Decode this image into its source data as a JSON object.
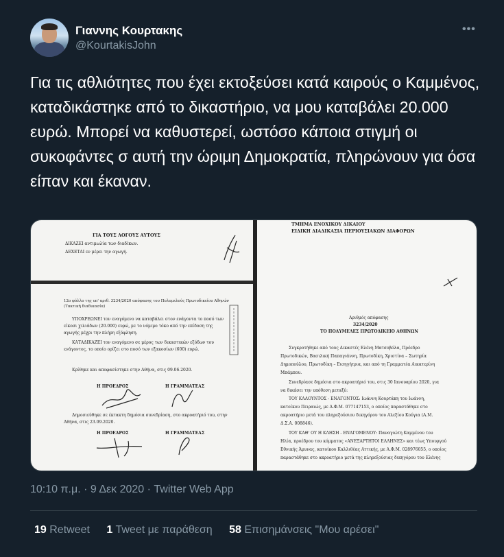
{
  "user": {
    "name": "Γιαννης Κουρτακης",
    "handle": "@KourtakisJohn"
  },
  "tweet": {
    "text": "Για τις αθλιότητες που έχει εκτοξεύσει κατά καιρούς ο Καμμένος, καταδικάστηκε από το δικαστήριο, να μου καταβάλει 20.000 ευρώ. Μπορεί να καθυστερεί, ωστόσο κάποια στιγμή οι συκοφάντες σ αυτή την ώριμη Δημοκρατία, πληρώνουν για όσα είπαν και έκαναν."
  },
  "more_label": "•••",
  "document_left": {
    "heading": "ΓΙΑ ΤΟΥΣ ΛΟΓΟΥΣ ΑΥΤΟΥΣ",
    "line1": "ΔΙΚΑΖΕΙ αντιμωλία των διαδίκων.",
    "line2": "ΔΕΧΕΤΑΙ εν μέρει την αγωγή.",
    "page_ref": "12ο φύλλο της υπ' αριθ. 3234/2020 απόφασης του Πολυμελούς Πρωτοδικείου Αθηνών",
    "page_ref2": "(Τακτική διαδικασία)",
    "p1": "ΥΠΟΧΡΕΩΝΕΙ τον εναγόμενο να καταβάλει στον ενάγοντα το ποσό των",
    "p1b": "είκοσι χιλιάδων (20.000) ευρώ, με το νόμιμο τόκο από την επίδοση της",
    "p1c": "αγωγής μέχρι την πλήρη εξόφληση.",
    "p2": "ΚΑΤΑΔΙΚΑΖΕΙ τον εναγόμενο σε μέρος των δικαστικών εξόδων του",
    "p2b": "ενάγοντος, το οποίο ορίζει στο ποσό των εξακοσίων (600) ευρώ.",
    "decided": "Κρίθηκε και αποφασίστηκε στην Αθήνα, στις 09.06.2020.",
    "president": "Η ΠΡΟΕΔΡΟΣ",
    "secretary": "Η ΓΡΑΜΜΑΤΕΑΣ",
    "published": "Δημοσιεύθηκε σε έκτακτη δημόσια συνεδρίαση, στο ακροατήριό του, στην",
    "published2": "Αθήνα, στις 23.09.2020.",
    "president2": "Η ΠΡΟΕΔΡΟΣ",
    "secretary2": "Η ΓΡΑΜΜΑΤΕΑΣ"
  },
  "document_right": {
    "h1": "ΤΜΗΜΑ ΕΝΟΧΙΚΟΥ ΔΙΚΑΙΟΥ",
    "h2": "ΕΙΔΙΚΗ ΔΙΑΔΙΚΑΣΙΑ ΠΕΡΙΟΥΣΙΑΚΩΝ ΔΙΑΦΟΡΩΝ",
    "num_label": "Αριθμός απόφασης",
    "num": "3234/2020",
    "court": "ΤΟ ΠΟΛΥΜΕΛΕΣ ΠΡΩΤΟΔΙΚΕΙΟ ΑΘΗΝΩΝ",
    "r1": "Συγκροτήθηκε από τους Δικαστές Ελένη Ματσοβόλα, Πρόεδρο",
    "r2": "Πρωτοδικών, Βασιλική Παπαγιάννη, Πρωτοδίκη, Χριστίνα – Σωτηρία",
    "r3": "Δημοπούλου, Πρωτοδίκη – Εισηγήτρια, και από τη Γραμματέα Αικατερίνη",
    "r4": "Μπάμπου.",
    "r5": "Συνεδρίασε δημόσια στο ακροατήριό του, στις 30 Ιανουαρίου 2020, για",
    "r6": "να δικάσει την υπόθεση μεταξύ:",
    "r7": "ΤΟΥ ΚΑΛΟΥΝΤΟΣ - ΕΝΑΓΟΝΤΟΣ: Ιωάννη Κουρτάκη του Ιωάννη,",
    "r8": "κατοίκου Πειραιώς, με Α.Φ.Μ. 077147153, ο οποίος παραστάθηκε στο",
    "r9": "ακροατήριο μετά του πληρεξούσιου δικηγόρου του Αλεξίου Κούγια (Α.Μ.",
    "r10": "Δ.Σ.Α. 008846).",
    "r11": "ΤΟΥ ΚΑΘ' ΟΥ Η ΚΛΗΣΗ - ΕΝΑΓΟΜΕΝΟΥ: Παναγιώτη Καμμένου του",
    "r12": "Ηλία, προέδρου του κόμματος «ΑΝΕΞΑΡΤΗΤΟΙ ΕΛΛΗΝΕΣ» και τέως Υπουργού",
    "r13": "Εθνικής Άμυνας, κατοίκου Καλλιθέας Αττικής, με Α.Φ.Μ. 028976055, ο οποίος",
    "r14": "παραστάθηκε στο ακροατήριο μετά της πληρεξούσιας δικηγόρου του Ελένης"
  },
  "meta": {
    "time": "10:10 π.μ.",
    "sep": " · ",
    "date": "9 Δεκ 2020",
    "source": "Twitter Web App"
  },
  "stats": {
    "retweets_count": "19",
    "retweets_label": "Retweet",
    "quotes_count": "1",
    "quotes_label": "Tweet με παράθεση",
    "likes_count": "58",
    "likes_label": "Επισημάνσεις \"Μου αρέσει\""
  }
}
